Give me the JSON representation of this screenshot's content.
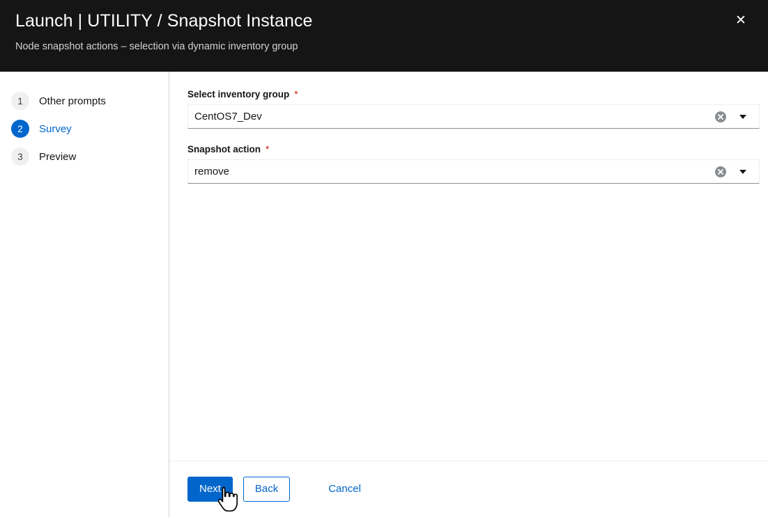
{
  "header": {
    "title": "Launch | UTILITY / Snapshot Instance",
    "subtitle": "Node snapshot actions – selection via dynamic inventory group",
    "close_icon": "close-icon",
    "close_glyph": "✕",
    "background": "#151515"
  },
  "nav": {
    "steps": [
      {
        "number": "1",
        "label": "Other prompts",
        "current": false
      },
      {
        "number": "2",
        "label": "Survey",
        "current": true
      },
      {
        "number": "3",
        "label": "Preview",
        "current": false
      }
    ]
  },
  "survey": {
    "fields": [
      {
        "label": "Select inventory group",
        "required_marker": "*",
        "value": "CentOS7_Dev",
        "clear_icon": "clear-circle-icon",
        "toggle_icon": "caret-down-icon"
      },
      {
        "label": "Snapshot action",
        "required_marker": "*",
        "value": "remove",
        "clear_icon": "clear-circle-icon",
        "toggle_icon": "caret-down-icon"
      }
    ]
  },
  "footer": {
    "next_label": "Next",
    "back_label": "Back",
    "cancel_label": "Cancel"
  },
  "colors": {
    "accent": "#0066cc",
    "header_bg": "#151515",
    "required": "#c9190b",
    "muted_border": "#d2d2d2"
  },
  "cursor": {
    "type": "pointer-hand-cursor"
  }
}
